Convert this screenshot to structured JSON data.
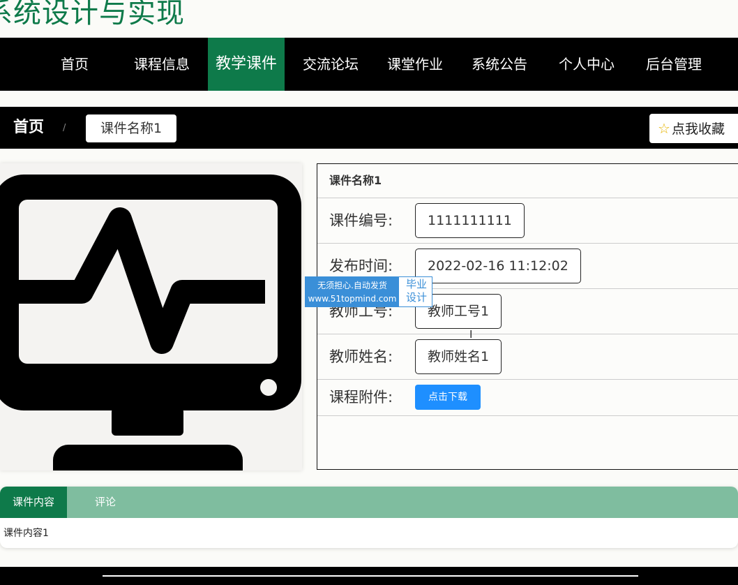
{
  "site": {
    "title": "系统设计与实现"
  },
  "nav": {
    "items": [
      {
        "label": "首页"
      },
      {
        "label": "课程信息"
      },
      {
        "label": "教学课件"
      },
      {
        "label": "交流论坛"
      },
      {
        "label": "课堂作业"
      },
      {
        "label": "系统公告"
      },
      {
        "label": "个人中心"
      },
      {
        "label": "后台管理"
      }
    ],
    "active_index": 2
  },
  "breadcrumb": {
    "home": "首页",
    "separator": "/",
    "current": "课件名称1",
    "favorite_label": "点我收藏"
  },
  "preview": {
    "icon": "monitor-pulse-icon"
  },
  "detail": {
    "header": "课件名称1",
    "rows": [
      {
        "label": "课件编号:",
        "value": "1111111111"
      },
      {
        "label": "发布时间:",
        "value": "2022-02-16 11:12:02"
      },
      {
        "label": "教师工号:",
        "value": "教师工号1"
      },
      {
        "label": "教师姓名:",
        "value": "教师姓名1"
      }
    ],
    "attachment_label": "课程附件:",
    "download_label": "点击下载"
  },
  "watermark": {
    "line1": "无须担心.自动发货",
    "line2": "www.51topmind.com",
    "right1": "毕业",
    "right2": "设计"
  },
  "tabs": {
    "items": [
      {
        "label": "课件内容"
      },
      {
        "label": "评论"
      }
    ],
    "content": "课件内容1"
  },
  "colors": {
    "brand_green": "#0e7a4a",
    "tab_strip": "#7fbd9f",
    "download_blue": "#1e8fff",
    "nav_bg": "#000000"
  }
}
